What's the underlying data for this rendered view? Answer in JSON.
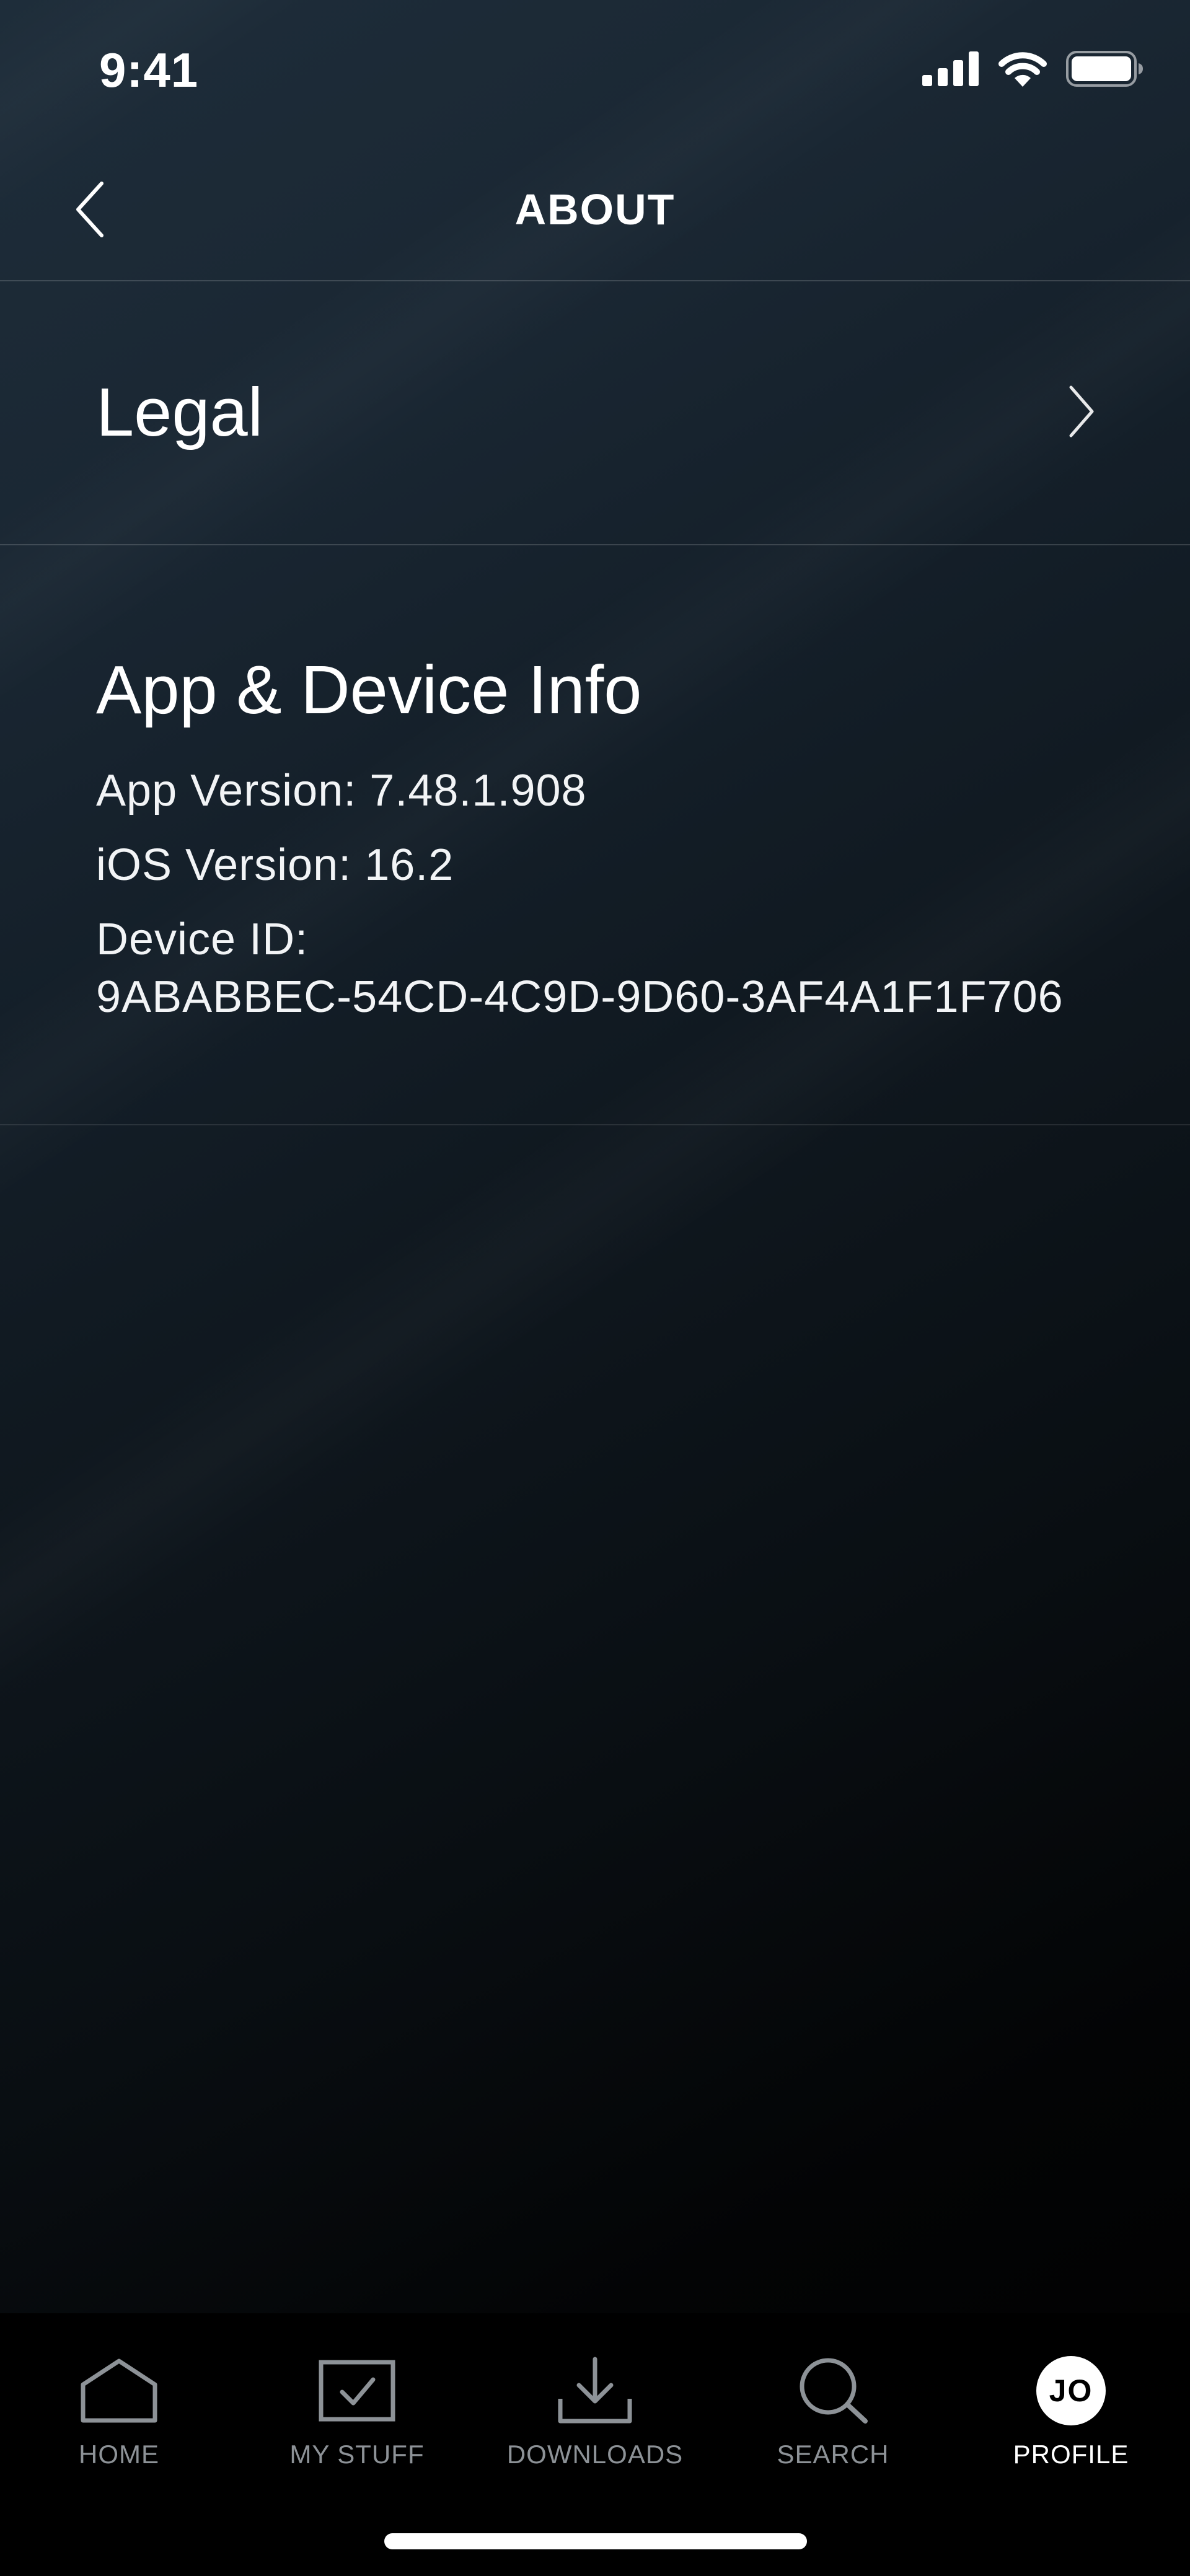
{
  "status_bar": {
    "time": "9:41"
  },
  "header": {
    "title": "ABOUT"
  },
  "legal": {
    "label": "Legal"
  },
  "info": {
    "title": "App & Device Info",
    "app_version": "App Version: 7.48.1.908",
    "ios_version": "iOS Version: 16.2",
    "device_id_label": "Device ID:",
    "device_id_value": "9ABABBEC-54CD-4C9D-9D60-3AF4A1F1F706"
  },
  "tabs": [
    {
      "label": "HOME",
      "icon": "home-icon"
    },
    {
      "label": "MY STUFF",
      "icon": "my-stuff-icon"
    },
    {
      "label": "DOWNLOADS",
      "icon": "download-icon"
    },
    {
      "label": "SEARCH",
      "icon": "search-icon"
    },
    {
      "label": "PROFILE",
      "icon": "avatar",
      "avatar_initials": "JO",
      "active": true
    }
  ],
  "colors": {
    "background_top": "#1e2d3a",
    "background_bottom": "#000000",
    "tab_inactive": "#8d9297",
    "tab_active": "#ffffff"
  }
}
